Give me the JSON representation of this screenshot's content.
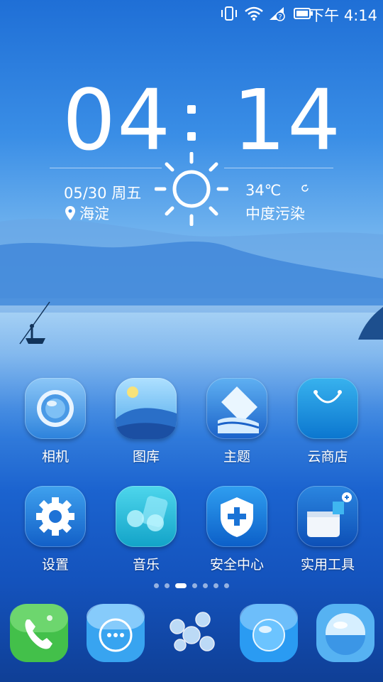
{
  "status_bar": {
    "time": "下午 4:14",
    "icons": [
      "vibrate-icon",
      "wifi-icon",
      "signal-no-sim-icon",
      "battery-icon"
    ]
  },
  "clock": {
    "hours": "04",
    "separator": ":",
    "minutes": "14"
  },
  "weather": {
    "date": "05/30 周五",
    "location": "海淀",
    "temperature": "34℃",
    "air_quality": "中度污染",
    "condition_icon": "sun-icon"
  },
  "apps_row1": [
    {
      "label": "相机",
      "icon": "camera-icon"
    },
    {
      "label": "图库",
      "icon": "gallery-icon"
    },
    {
      "label": "主题",
      "icon": "theme-icon"
    },
    {
      "label": "云商店",
      "icon": "store-bag-icon"
    }
  ],
  "apps_row2": [
    {
      "label": "设置",
      "icon": "gear-icon"
    },
    {
      "label": "音乐",
      "icon": "music-icon"
    },
    {
      "label": "安全中心",
      "icon": "shield-plus-icon"
    },
    {
      "label": "实用工具",
      "icon": "toolbox-icon"
    }
  ],
  "page_indicator": {
    "count": 7,
    "active": 3
  },
  "dock": [
    {
      "name": "phone",
      "icon": "phone-icon"
    },
    {
      "name": "messages",
      "icon": "message-bubble-icon"
    },
    {
      "name": "app-drawer",
      "icon": "bubbles-icon"
    },
    {
      "name": "browser",
      "icon": "browser-orb-icon"
    },
    {
      "name": "camera-lens",
      "icon": "lens-orb-icon"
    }
  ]
}
